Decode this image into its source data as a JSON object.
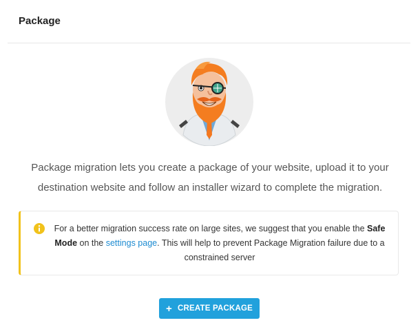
{
  "header": {
    "title": "Package"
  },
  "intro": {
    "line1": "Package migration lets you create a package of your website, upload it to your",
    "line2": "destination website and follow an installer wizard to complete the migration."
  },
  "notice": {
    "icon": "info-icon",
    "text_before": "For a better migration success rate on large sites, we suggest that you enable the ",
    "bold1": "Safe Mode",
    "text_mid": " on the ",
    "link": "settings page",
    "text_after": ". This will help to prevent Package Migration failure due to a constrained server",
    "accent_color": "#f1c21b",
    "link_color": "#1d8bd1"
  },
  "button": {
    "icon": "plus-icon",
    "label": "CREATE PACKAGE",
    "color": "#21a1dc"
  }
}
